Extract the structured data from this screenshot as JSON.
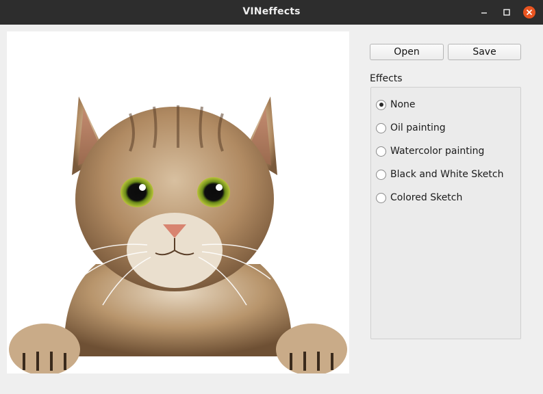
{
  "window": {
    "title": "VINeffects"
  },
  "toolbar": {
    "open_label": "Open",
    "save_label": "Save"
  },
  "effects": {
    "label": "Effects",
    "selected": "None",
    "options": [
      {
        "label": "None",
        "checked": true
      },
      {
        "label": "Oil painting",
        "checked": false
      },
      {
        "label": "Watercolor painting",
        "checked": false
      },
      {
        "label": "Black and White Sketch",
        "checked": false
      },
      {
        "label": "Colored Sketch",
        "checked": false
      }
    ]
  },
  "colors": {
    "titlebar": "#2d2d2d",
    "window_bg": "#efefef",
    "close_button": "#e95420"
  },
  "icons": [
    "minimize-icon",
    "maximize-icon",
    "close-icon"
  ]
}
